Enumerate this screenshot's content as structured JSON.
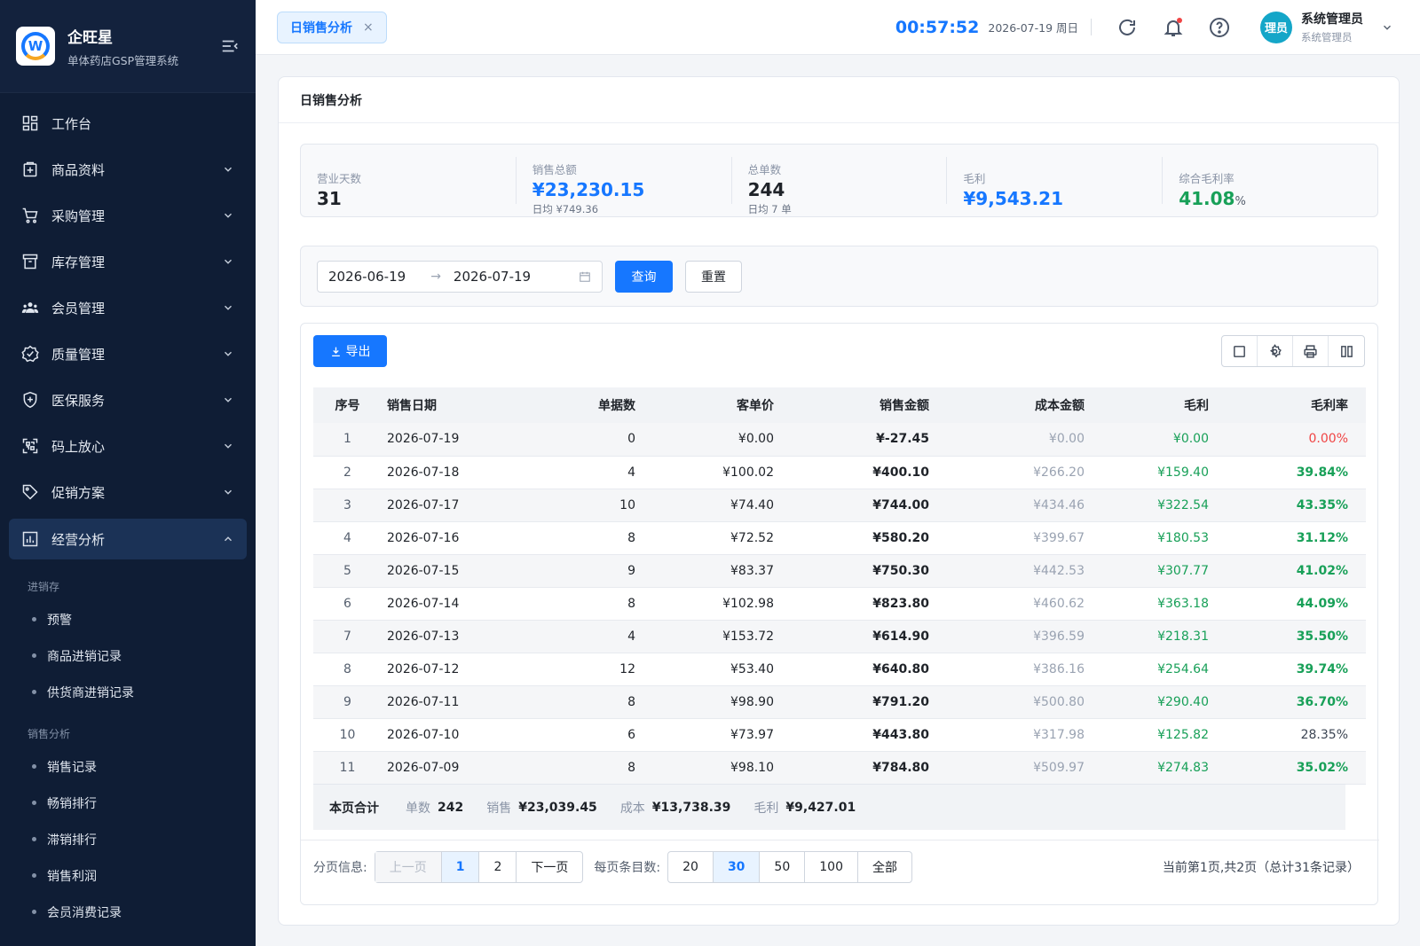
{
  "brand": {
    "name": "企旺星",
    "subtitle": "单体药店GSP管理系统",
    "logo_letter": "W"
  },
  "sidebar": {
    "items": [
      {
        "label": "工作台",
        "icon": "dashboard-icon",
        "expandable": false
      },
      {
        "label": "商品资料",
        "icon": "medicine-box-icon",
        "expandable": true
      },
      {
        "label": "采购管理",
        "icon": "cart-icon",
        "expandable": true
      },
      {
        "label": "库存管理",
        "icon": "archive-icon",
        "expandable": true
      },
      {
        "label": "会员管理",
        "icon": "users-icon",
        "expandable": true
      },
      {
        "label": "质量管理",
        "icon": "badge-check-icon",
        "expandable": true
      },
      {
        "label": "医保服务",
        "icon": "shield-plus-icon",
        "expandable": true
      },
      {
        "label": "码上放心",
        "icon": "qrcode-scan-icon",
        "expandable": true
      },
      {
        "label": "促销方案",
        "icon": "tag-icon",
        "expandable": true
      },
      {
        "label": "经营分析",
        "icon": "bar-chart-icon",
        "expandable": true,
        "active": true
      }
    ],
    "groups": [
      {
        "title": "进销存",
        "items": [
          "预警",
          "商品进销记录",
          "供货商进销记录"
        ]
      },
      {
        "title": "销售分析",
        "items": [
          "销售记录",
          "畅销排行",
          "滞销排行",
          "销售利润",
          "会员消费记录"
        ]
      }
    ]
  },
  "topbar": {
    "tab_label": "日销售分析",
    "tab_close": "×",
    "clock": "00:57:52",
    "date": "2026-07-19 周日",
    "user_avatar": "理员",
    "user_name": "系统管理员",
    "user_role": "系统管理员"
  },
  "page": {
    "title": "日销售分析"
  },
  "stats": [
    {
      "label": "营业天数",
      "value": "31",
      "sub": "",
      "color": "default"
    },
    {
      "label": "销售总额",
      "value": "¥23,230.15",
      "sub": "日均 ¥749.36",
      "color": "blue"
    },
    {
      "label": "总单数",
      "value": "244",
      "sub": "日均 7 单",
      "color": "default"
    },
    {
      "label": "毛利",
      "value": "¥9,543.21",
      "sub": "",
      "color": "blue"
    },
    {
      "label": "综合毛利率",
      "value": "41.08",
      "unit": "%",
      "sub": "",
      "color": "green"
    }
  ],
  "filter": {
    "start_date": "2026-06-19",
    "end_date": "2026-07-19",
    "arrow": "→",
    "query_label": "查询",
    "reset_label": "重置"
  },
  "toolbar": {
    "export_label": "导出"
  },
  "table": {
    "columns": [
      "序号",
      "销售日期",
      "单据数",
      "客单价",
      "销售金额",
      "成本金额",
      "毛利",
      "毛利率"
    ],
    "rows": [
      {
        "idx": "1",
        "date": "2026-07-19",
        "count": "0",
        "avg": "¥0.00",
        "sales": "¥-27.45",
        "cost": "¥0.00",
        "profit": "¥0.00",
        "rate": "0.00%",
        "rate_style": "zero"
      },
      {
        "idx": "2",
        "date": "2026-07-18",
        "count": "4",
        "avg": "¥100.02",
        "sales": "¥400.10",
        "cost": "¥266.20",
        "profit": "¥159.40",
        "rate": "39.84%",
        "rate_style": "hi"
      },
      {
        "idx": "3",
        "date": "2026-07-17",
        "count": "10",
        "avg": "¥74.40",
        "sales": "¥744.00",
        "cost": "¥434.46",
        "profit": "¥322.54",
        "rate": "43.35%",
        "rate_style": "hi"
      },
      {
        "idx": "4",
        "date": "2026-07-16",
        "count": "8",
        "avg": "¥72.52",
        "sales": "¥580.20",
        "cost": "¥399.67",
        "profit": "¥180.53",
        "rate": "31.12%",
        "rate_style": "hi"
      },
      {
        "idx": "5",
        "date": "2026-07-15",
        "count": "9",
        "avg": "¥83.37",
        "sales": "¥750.30",
        "cost": "¥442.53",
        "profit": "¥307.77",
        "rate": "41.02%",
        "rate_style": "hi"
      },
      {
        "idx": "6",
        "date": "2026-07-14",
        "count": "8",
        "avg": "¥102.98",
        "sales": "¥823.80",
        "cost": "¥460.62",
        "profit": "¥363.18",
        "rate": "44.09%",
        "rate_style": "hi"
      },
      {
        "idx": "7",
        "date": "2026-07-13",
        "count": "4",
        "avg": "¥153.72",
        "sales": "¥614.90",
        "cost": "¥396.59",
        "profit": "¥218.31",
        "rate": "35.50%",
        "rate_style": "hi"
      },
      {
        "idx": "8",
        "date": "2026-07-12",
        "count": "12",
        "avg": "¥53.40",
        "sales": "¥640.80",
        "cost": "¥386.16",
        "profit": "¥254.64",
        "rate": "39.74%",
        "rate_style": "hi"
      },
      {
        "idx": "9",
        "date": "2026-07-11",
        "count": "8",
        "avg": "¥98.90",
        "sales": "¥791.20",
        "cost": "¥500.80",
        "profit": "¥290.40",
        "rate": "36.70%",
        "rate_style": "hi"
      },
      {
        "idx": "10",
        "date": "2026-07-10",
        "count": "6",
        "avg": "¥73.97",
        "sales": "¥443.80",
        "cost": "¥317.98",
        "profit": "¥125.82",
        "rate": "28.35%",
        "rate_style": "norm"
      },
      {
        "idx": "11",
        "date": "2026-07-09",
        "count": "8",
        "avg": "¥98.10",
        "sales": "¥784.80",
        "cost": "¥509.97",
        "profit": "¥274.83",
        "rate": "35.02%",
        "rate_style": "hi"
      }
    ]
  },
  "summary": {
    "title": "本页合计",
    "count_label": "单数",
    "count": "242",
    "sales_label": "销售",
    "sales": "¥23,039.45",
    "cost_label": "成本",
    "cost": "¥13,738.39",
    "profit_label": "毛利",
    "profit": "¥9,427.01"
  },
  "pager": {
    "label": "分页信息:",
    "prev": "上一页",
    "pages": [
      "1",
      "2"
    ],
    "current_page": "1",
    "next": "下一页",
    "size_label": "每页条目数:",
    "sizes": [
      "20",
      "30",
      "50",
      "100",
      "全部"
    ],
    "current_size": "30",
    "info": "当前第1页,共2页（总计31条记录）"
  },
  "colors": {
    "primary": "#1677ff",
    "success": "#18a058",
    "danger": "#f04444",
    "sidebar_bg": "#0f1d35"
  }
}
